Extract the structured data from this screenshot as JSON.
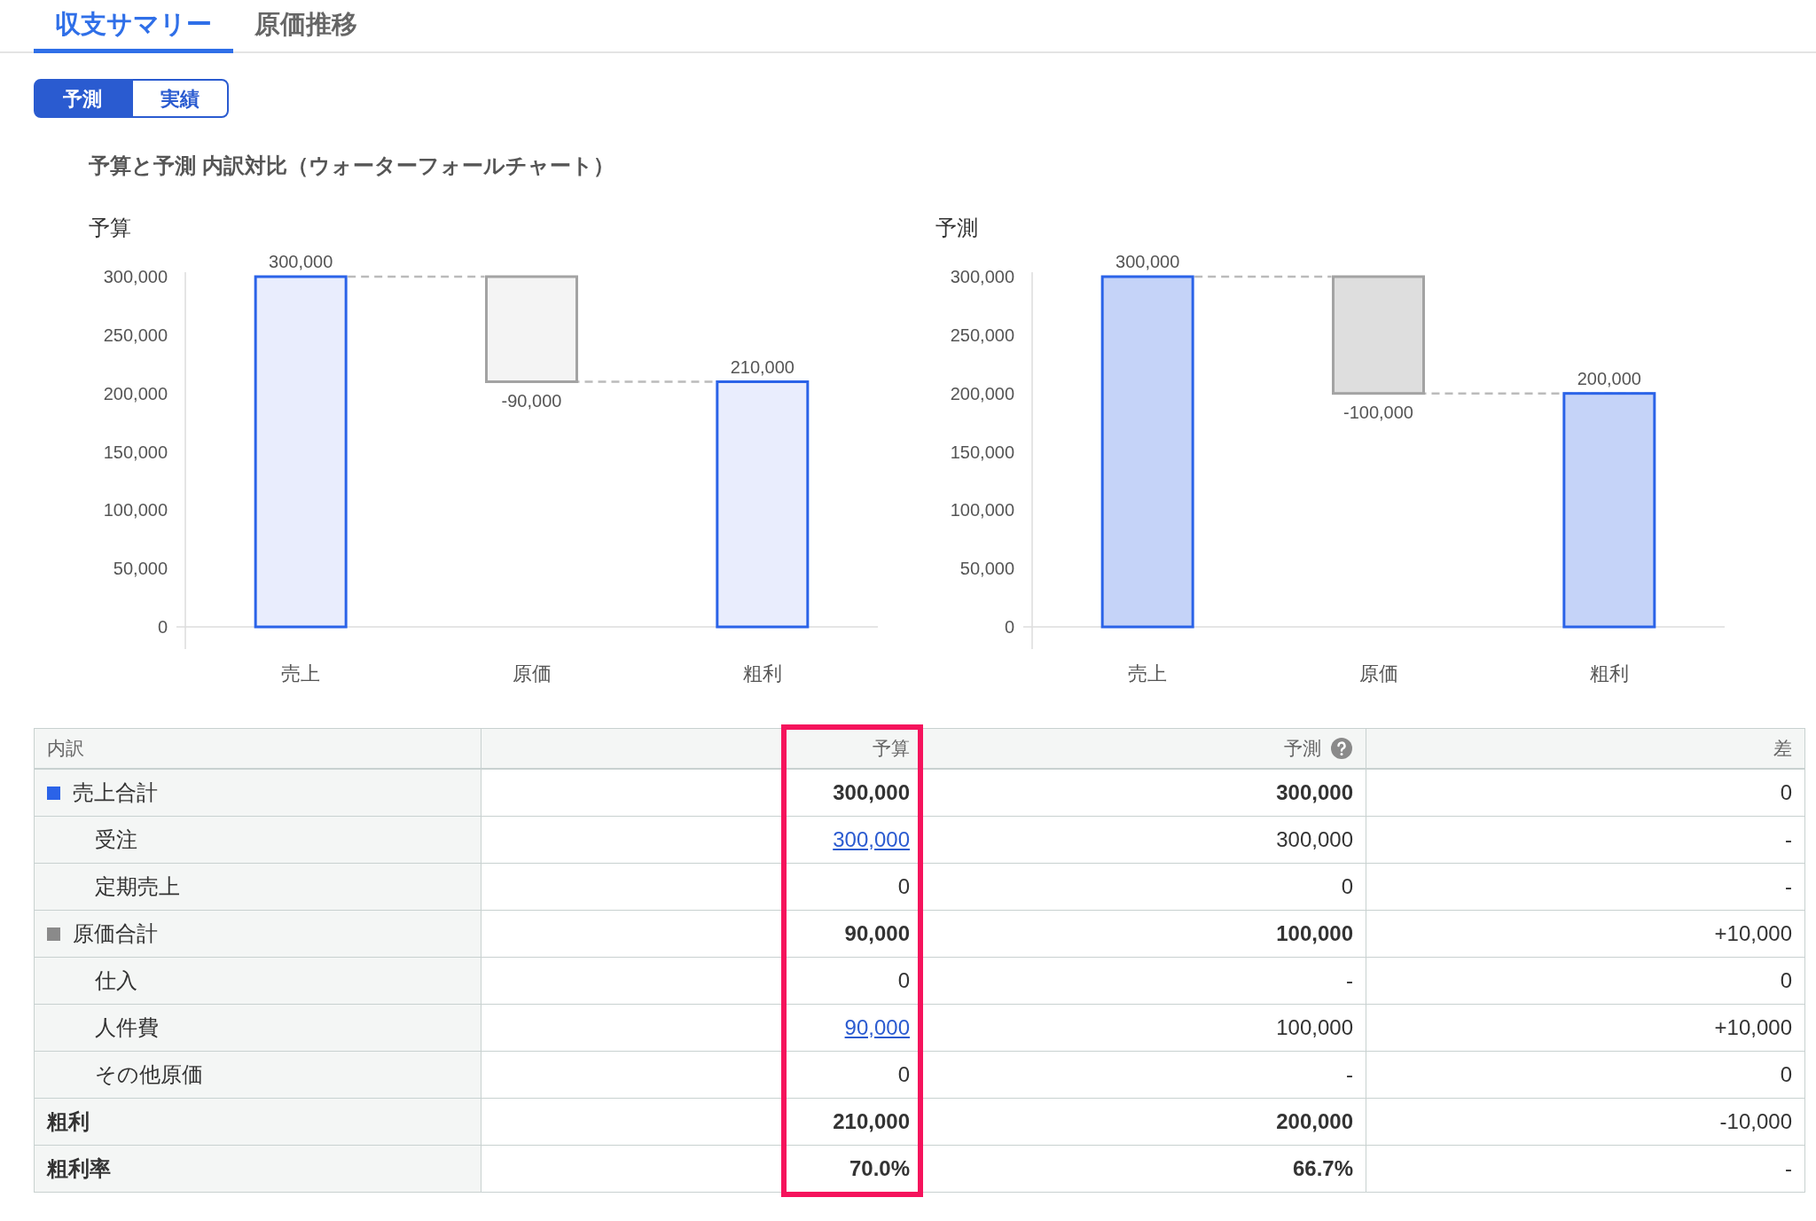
{
  "tabs": [
    {
      "label": "収支サマリー",
      "selected": true
    },
    {
      "label": "原価推移",
      "selected": false
    }
  ],
  "toggle": [
    {
      "label": "予測",
      "selected": true
    },
    {
      "label": "実績",
      "selected": false
    }
  ],
  "section_title": "予算と予測 内訳対比（ウォーターフォールチャート）",
  "charts": [
    {
      "emphasized": false,
      "chart_data": {
        "type": "bar",
        "title": "予算",
        "categories": [
          "売上",
          "原価",
          "粗利"
        ],
        "series": [
          {
            "color": "#2b63e8",
            "values": [
              300000,
              null,
              210000
            ]
          }
        ],
        "ylim": [
          0,
          300000
        ],
        "yticks": [
          {
            "value": 0,
            "label": "0"
          },
          {
            "value": 50000,
            "label": "50,000"
          },
          {
            "value": 100000,
            "label": "100,000"
          },
          {
            "value": 150000,
            "label": "150,000"
          },
          {
            "value": 200000,
            "label": "200,000"
          },
          {
            "value": 250000,
            "label": "250,000"
          },
          {
            "value": 300000,
            "label": "300,000"
          }
        ],
        "value_labels": [
          "300,000",
          null,
          "210,000"
        ],
        "annotations": [
          "-90,000"
        ]
      }
    },
    {
      "emphasized": true,
      "chart_data": {
        "type": "bar",
        "title": "予測",
        "categories": [
          "売上",
          "原価",
          "粗利"
        ],
        "series": [
          {
            "color": "#2b63e8",
            "values": [
              300000,
              null,
              200000
            ]
          }
        ],
        "ylim": [
          0,
          300000
        ],
        "yticks": [
          {
            "value": 0,
            "label": "0"
          },
          {
            "value": 50000,
            "label": "50,000"
          },
          {
            "value": 100000,
            "label": "100,000"
          },
          {
            "value": 150000,
            "label": "150,000"
          },
          {
            "value": 200000,
            "label": "200,000"
          },
          {
            "value": 250000,
            "label": "250,000"
          },
          {
            "value": 300000,
            "label": "300,000"
          }
        ],
        "value_labels": [
          "300,000",
          null,
          "200,000"
        ],
        "annotations": [
          "-100,000"
        ]
      }
    }
  ],
  "table": {
    "row_header": "内訳",
    "columns": [
      {
        "label": "予算",
        "highlighted": true
      },
      {
        "label": "予測",
        "help": true
      },
      {
        "label": "差"
      }
    ],
    "rows": [
      {
        "kind": "group",
        "label": "売上合計",
        "color": "#2b63e8",
        "cells": [
          {
            "text": "300,000",
            "link": false
          },
          {
            "text": "300,000",
            "link": false
          },
          {
            "text": "0",
            "link": false
          }
        ],
        "children": [
          {
            "kind": "item",
            "label": "受注",
            "cells": [
              {
                "text": "300,000",
                "link": true
              },
              {
                "text": "300,000",
                "link": false
              },
              {
                "text": "-",
                "link": false
              }
            ]
          },
          {
            "kind": "item",
            "label": "定期売上",
            "cells": [
              {
                "text": "0",
                "link": false
              },
              {
                "text": "0",
                "link": false
              },
              {
                "text": "-",
                "link": false
              }
            ]
          }
        ]
      },
      {
        "kind": "group",
        "label": "原価合計",
        "color": "#8a8a8a",
        "cells": [
          {
            "text": "90,000",
            "link": false
          },
          {
            "text": "100,000",
            "link": false
          },
          {
            "text": "+10,000",
            "link": false
          }
        ],
        "children": [
          {
            "kind": "item",
            "label": "仕入",
            "cells": [
              {
                "text": "0",
                "link": false
              },
              {
                "text": "-",
                "link": false
              },
              {
                "text": "0",
                "link": false
              }
            ]
          },
          {
            "kind": "item",
            "label": "人件費",
            "cells": [
              {
                "text": "90,000",
                "link": true
              },
              {
                "text": "100,000",
                "link": false
              },
              {
                "text": "+10,000",
                "link": false
              }
            ]
          },
          {
            "kind": "item",
            "label": "その他原価",
            "cells": [
              {
                "text": "0",
                "link": false
              },
              {
                "text": "-",
                "link": false
              },
              {
                "text": "0",
                "link": false
              }
            ]
          }
        ]
      },
      {
        "kind": "summary",
        "label": "粗利",
        "cells": [
          {
            "text": "210,000",
            "link": false
          },
          {
            "text": "200,000",
            "link": false
          },
          {
            "text": "-10,000",
            "link": false
          }
        ]
      },
      {
        "kind": "summary",
        "label": "粗利率",
        "cells": [
          {
            "text": "70.0%",
            "link": false
          },
          {
            "text": "66.7%",
            "link": false
          },
          {
            "text": "-",
            "link": false
          }
        ]
      }
    ]
  }
}
